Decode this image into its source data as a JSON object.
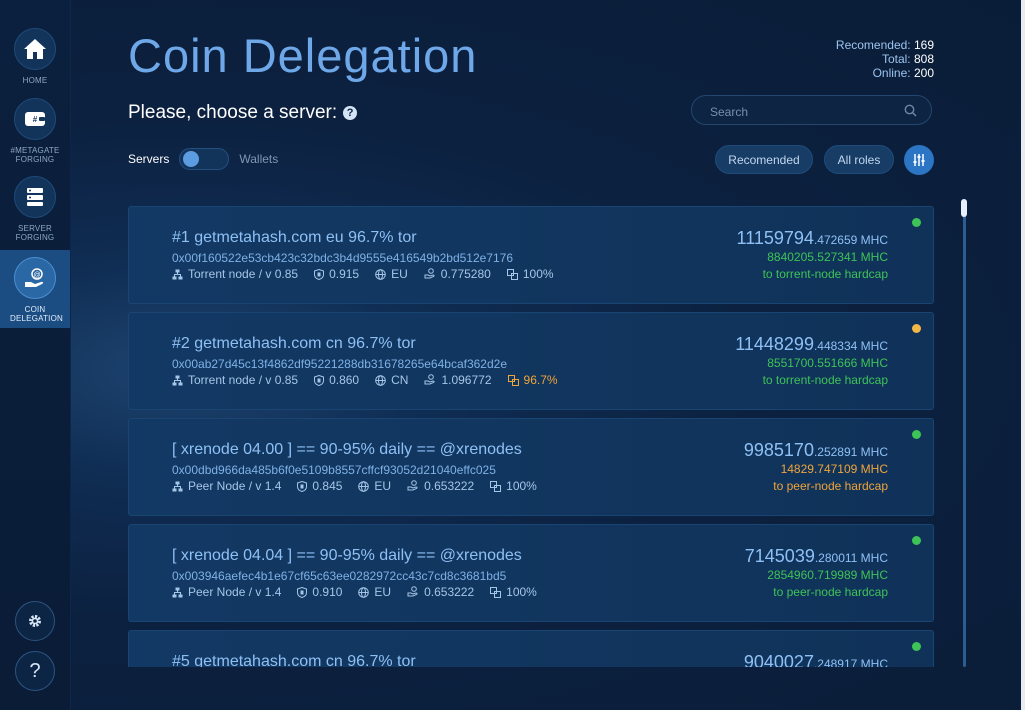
{
  "sidebar": {
    "items": [
      {
        "label": "HOME",
        "icon": "home-icon"
      },
      {
        "label": "#METAGATE FORGING",
        "icon": "wallet-icon"
      },
      {
        "label": "SERVER FORGING",
        "icon": "server-icon"
      },
      {
        "label": "COIN DELEGATION",
        "icon": "delegation-icon",
        "active": true
      }
    ],
    "settings_icon": "gear-icon",
    "help_label": "?"
  },
  "header": {
    "title": "Coin Delegation",
    "subtitle": "Please, choose a server:",
    "help_glyph": "?",
    "stats": {
      "recommended_label": "Recomended:",
      "recommended_value": "169",
      "total_label": "Total:",
      "total_value": "808",
      "online_label": "Online:",
      "online_value": "200"
    }
  },
  "search": {
    "placeholder": "Search"
  },
  "toggle": {
    "left_label": "Servers",
    "right_label": "Wallets"
  },
  "filters": {
    "recommended_label": "Recomended",
    "all_roles_label": "All roles"
  },
  "colors": {
    "accent": "#6fa8e8",
    "green": "#3ec357",
    "orange": "#f0a43a",
    "card": "#123964"
  },
  "servers": [
    {
      "name": "#1 getmetahash.com eu 96.7% tor",
      "address": "0x00f160522e53cb423c32bdc3b4d9555e416549b2bd512e7176",
      "node_type": "Torrent node / v 0.85",
      "score": "0.915",
      "region": "EU",
      "ratio": "0.775280",
      "availability": "100%",
      "amount_int": "11159794",
      "amount_frac": ".472659 MHC",
      "remaining": "8840205.527341 MHC",
      "cap_text": "to torrent-node hardcap",
      "status": "green",
      "cap_status": "green",
      "avail_status": "normal"
    },
    {
      "name": "#2 getmetahash.com cn 96.7% tor",
      "address": "0x00ab27d45c13f4862df95221288db31678265e64bcaf362d2e",
      "node_type": "Torrent node / v 0.85",
      "score": "0.860",
      "region": "CN",
      "ratio": "1.096772",
      "availability": "96.7%",
      "amount_int": "11448299",
      "amount_frac": ".448334 MHC",
      "remaining": "8551700.551666 MHC",
      "cap_text": "to torrent-node hardcap",
      "status": "orange",
      "cap_status": "green",
      "avail_status": "orange"
    },
    {
      "name": "[ xrenode 04.00 ] == 90-95% daily == @xrenodes",
      "address": "0x00dbd966da485b6f0e5109b8557cffcf93052d21040effc025",
      "node_type": "Peer Node / v 1.4",
      "score": "0.845",
      "region": "EU",
      "ratio": "0.653222",
      "availability": "100%",
      "amount_int": "9985170",
      "amount_frac": ".252891 MHC",
      "remaining": "14829.747109 MHC",
      "cap_text": "to peer-node hardcap",
      "status": "green",
      "cap_status": "orange",
      "avail_status": "normal"
    },
    {
      "name": "[ xrenode 04.04 ] == 90-95% daily == @xrenodes",
      "address": "0x003946aefec4b1e67cf65c63ee0282972cc43c7cd8c3681bd5",
      "node_type": "Peer Node / v 1.4",
      "score": "0.910",
      "region": "EU",
      "ratio": "0.653222",
      "availability": "100%",
      "amount_int": "7145039",
      "amount_frac": ".280011 MHC",
      "remaining": "2854960.719989 MHC",
      "cap_text": "to peer-node hardcap",
      "status": "green",
      "cap_status": "green",
      "avail_status": "normal"
    },
    {
      "name": "#5 getmetahash.com cn 96.7% tor",
      "address": "",
      "node_type": "",
      "score": "",
      "region": "",
      "ratio": "",
      "availability": "",
      "amount_int": "9040027",
      "amount_frac": ".248917 MHC",
      "remaining": "",
      "cap_text": "",
      "status": "green",
      "cap_status": "green",
      "avail_status": "normal"
    }
  ]
}
